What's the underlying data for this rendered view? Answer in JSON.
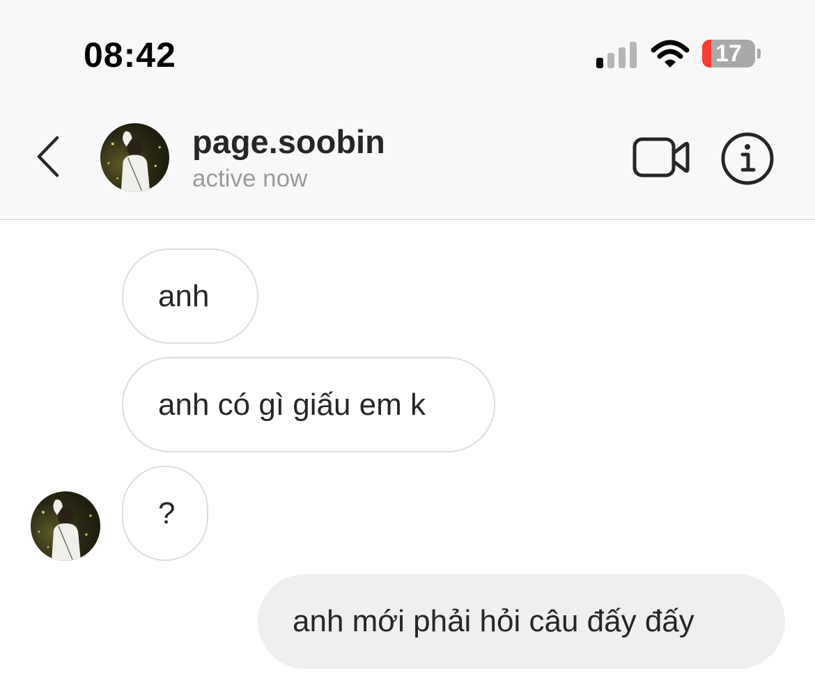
{
  "status_bar": {
    "time": "08:42",
    "battery_percent": 17,
    "battery_label": "17",
    "signal_bars_active": 1,
    "signal_bars_total": 4
  },
  "header": {
    "username": "page.soobin",
    "presence": "active now",
    "back_icon": "chevron-left-icon",
    "video_icon": "video-camera-icon",
    "info_icon": "info-icon"
  },
  "messages": [
    {
      "direction": "incoming",
      "text": "anh"
    },
    {
      "direction": "incoming",
      "text": "anh có gì giấu em k"
    },
    {
      "direction": "incoming",
      "text": "?"
    },
    {
      "direction": "outgoing",
      "text": "anh mới phải hỏi câu đấy đấy"
    }
  ],
  "colors": {
    "header_bg": "#f8f8f8",
    "text": "#262626",
    "secondary_text": "#9a9a9a",
    "incoming_border": "#dcdcdc",
    "outgoing_bg": "#efefef",
    "battery_low": "#ff3b30"
  }
}
